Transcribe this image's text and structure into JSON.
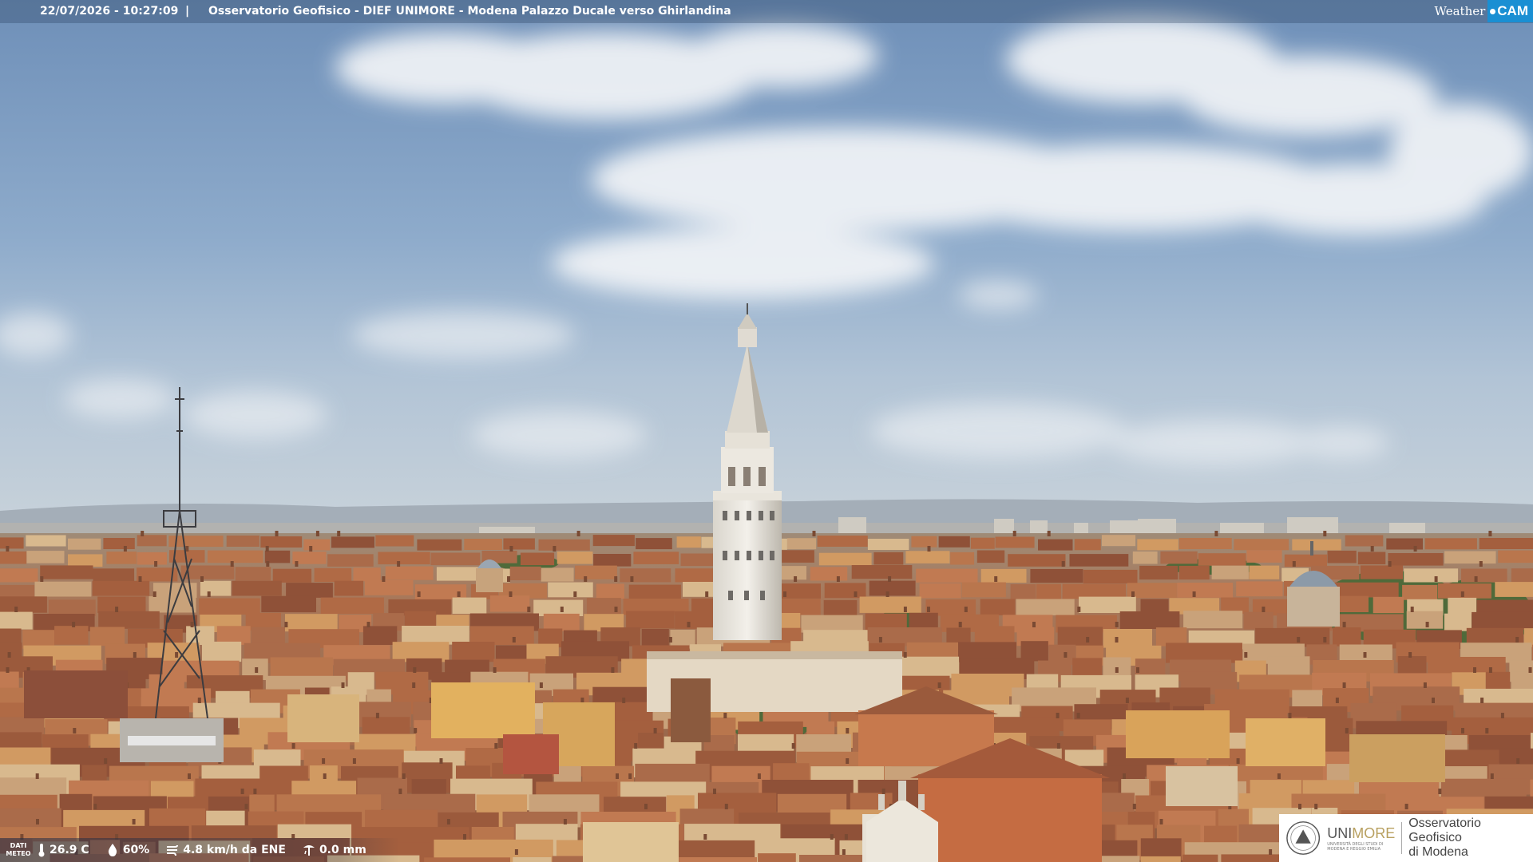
{
  "header": {
    "datetime": "22/07/2026 - 10:27:09",
    "separator": "|",
    "location": "Osservatorio Geofisico - DIEF UNIMORE - Modena Palazzo Ducale verso Ghirlandina"
  },
  "brand": {
    "weather": "Weather",
    "cam": "CAM",
    "accent": "#1a8fd3"
  },
  "weather_bar": {
    "label_line1": "DATI",
    "label_line2": "METEO",
    "temperature": "26.9 C",
    "humidity": "60%",
    "wind": "4.8 km/h da ENE",
    "rain": "0.0 mm"
  },
  "logo": {
    "uni_a": "UNI",
    "uni_b": "MORE",
    "uni_sub": "UNIVERSITÀ DEGLI STUDI DI MODENA E REGGIO EMILIA",
    "obs_line1": "Osservatorio Geofisico",
    "obs_line2": "di Modena"
  },
  "icons": {
    "temperature": "thermometer-icon",
    "humidity": "droplet-icon",
    "wind": "wind-icon",
    "rain": "rain-gauge-icon"
  }
}
